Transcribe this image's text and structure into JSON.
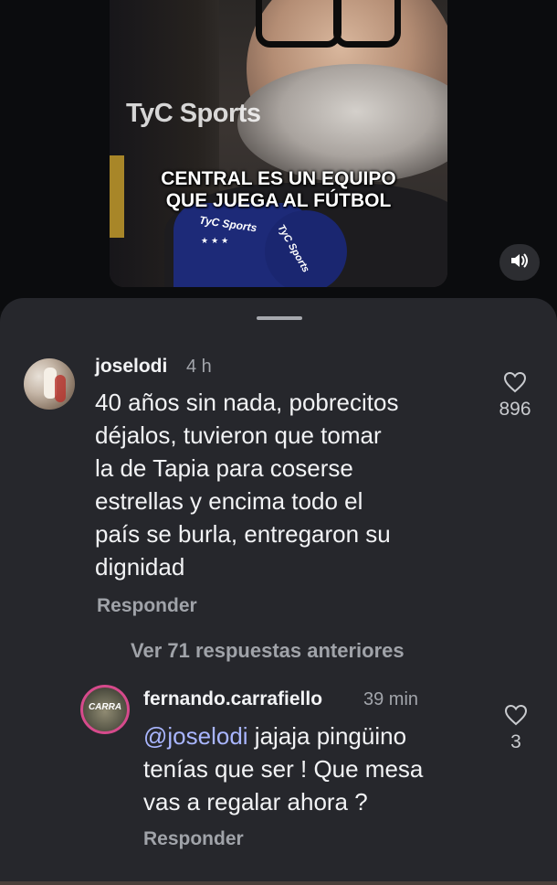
{
  "video": {
    "watermark": "TyC Sports",
    "caption_line1": "CENTRAL ES UN EQUIPO",
    "caption_line2": "QUE JUEGA AL FÚTBOL",
    "mic_logo": "TyC Sports",
    "mic_stars": "★★★",
    "volume_icon": "speaker-icon"
  },
  "comments": [
    {
      "username": "joselodi",
      "time": "4 h",
      "text_lines": [
        "40 años sin nada, pobrecitos",
        "déjalos, tuvieron que tomar",
        "la de Tapia para coserse",
        "estrellas y encima todo el",
        "país se burla, entregaron su",
        "dignidad"
      ],
      "reply_label": "Responder",
      "likes": "896"
    }
  ],
  "view_replies": "Ver 71 respuestas anteriores",
  "reply": {
    "username": "fernando.carrafiello",
    "time": "39 min",
    "avatar_text": "CARRA",
    "mention": "@joselodi",
    "text_line1": " jajaja pingüino",
    "text_line2": "tenías que ser ! Que mesa",
    "text_line3": "vas a regalar ahora ?",
    "reply_label": "Responder",
    "likes": "3"
  },
  "colors": {
    "sheet_bg": "#26272c",
    "mention": "#a9b6ff",
    "story_ring": "#d64a8c"
  }
}
